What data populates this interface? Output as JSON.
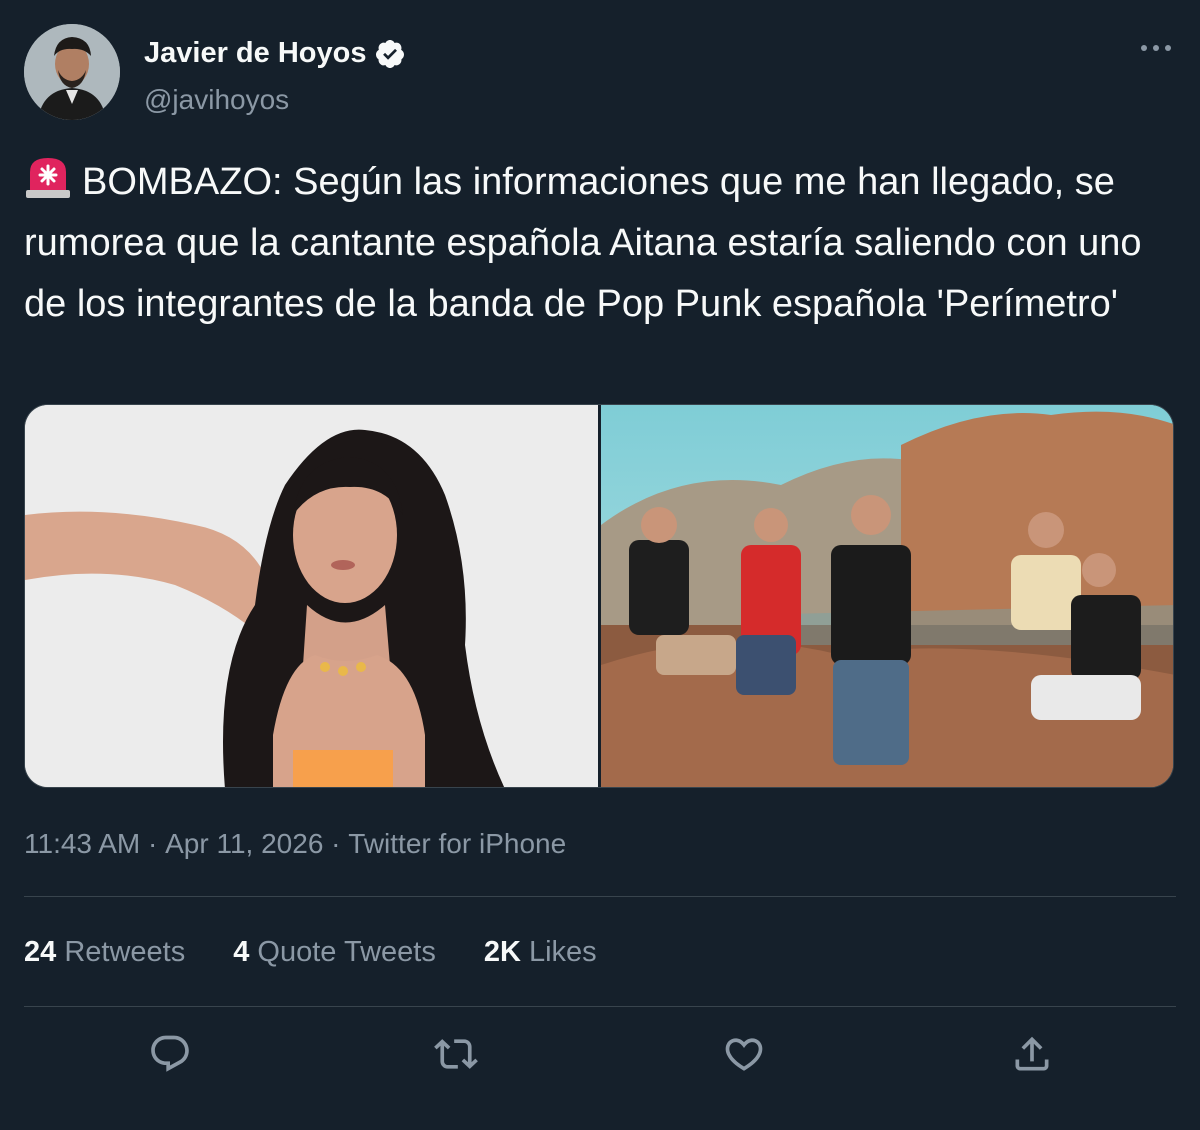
{
  "author": {
    "display_name": "Javier de Hoyos",
    "handle": "@javihoyos",
    "verified_icon": "verified-badge-icon",
    "avatar": "avatar"
  },
  "more_icon": "more-horizontal-icon",
  "tweet": {
    "emoji": "siren-icon",
    "text": "BOMBAZO: Según las informaciones que me han llegado, se rumorea que la cantante española Aitana estaría saliendo con uno de los integrantes de la banda de Pop Punk española 'Perímetro'"
  },
  "meta": {
    "time": "11:43 AM",
    "separator": " · ",
    "date": "Apr 11, 2026",
    "source": "Twitter for iPhone"
  },
  "stats": {
    "retweets": {
      "num": "24",
      "label": "Retweets"
    },
    "quotes": {
      "num": "4",
      "label": "Quote Tweets"
    },
    "likes": {
      "num": "2K",
      "label": "Likes"
    }
  },
  "actions": [
    "reply-icon",
    "retweet-icon",
    "like-icon",
    "share-icon"
  ],
  "colors": {
    "background": "#15202b",
    "text": "#f7f9f9",
    "secondary": "#8b98a5",
    "divider": "#38444d"
  }
}
